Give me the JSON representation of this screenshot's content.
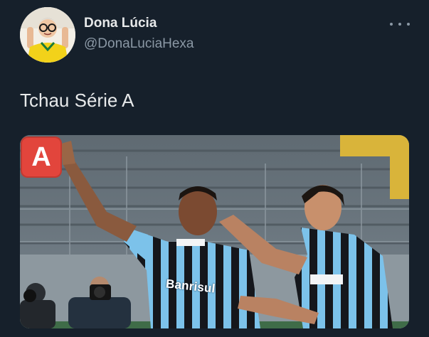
{
  "tweet": {
    "display_name": "Dona Lúcia",
    "handle": "@DonaLuciaHexa",
    "text": "Tchau Série A",
    "media": {
      "badge_letter": "A",
      "jersey_sponsor": "Banrisul"
    }
  },
  "icons": {
    "more": "more-horizontal-icon",
    "badge": "a-button-emoji"
  },
  "colors": {
    "background": "#16202b",
    "text_primary": "#e7e9ea",
    "text_secondary": "#8b98a5",
    "badge_red": "#e2453c"
  }
}
